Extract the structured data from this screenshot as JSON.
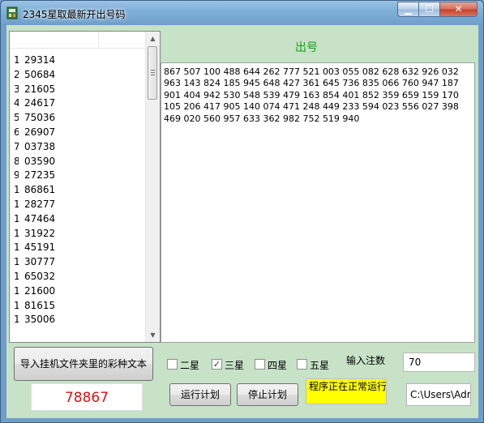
{
  "window": {
    "title": "2345星取最新开出号码"
  },
  "titlebar": {
    "minimize_glyph": "▁",
    "maximize_glyph": "☐",
    "close_glyph": "✕",
    "icon": "app-icon"
  },
  "list": {
    "rows": [
      {
        "idx": "1",
        "value": "29314"
      },
      {
        "idx": "2",
        "value": "50684"
      },
      {
        "idx": "3",
        "value": "21605"
      },
      {
        "idx": "4",
        "value": "24617"
      },
      {
        "idx": "5",
        "value": "75036"
      },
      {
        "idx": "6",
        "value": "26907"
      },
      {
        "idx": "7",
        "value": "03738"
      },
      {
        "idx": "8",
        "value": "03590"
      },
      {
        "idx": "9",
        "value": "27235"
      },
      {
        "idx": "1",
        "value": "86861"
      },
      {
        "idx": "1",
        "value": "28277"
      },
      {
        "idx": "1",
        "value": "47464"
      },
      {
        "idx": "1",
        "value": "31922"
      },
      {
        "idx": "1",
        "value": "45191"
      },
      {
        "idx": "1",
        "value": "30777"
      },
      {
        "idx": "1",
        "value": "65032"
      },
      {
        "idx": "1",
        "value": "21600"
      },
      {
        "idx": "1",
        "value": "81615"
      },
      {
        "idx": "1",
        "value": "35006"
      }
    ],
    "scroll_up_glyph": "▲",
    "scroll_down_glyph": "▼"
  },
  "result": {
    "title": "出号",
    "numbers": "867 507 100 488 644 262 777 521 003 055 082 628 632 926 032 963 143 824 185 945 648 427 361 645 736 835 066 760 947 187 901 404 942 530 548 539 479 163 854 401 852 359 659 159 170 105 206 417 905 140 074 471 248 449 233 594 023 556 027 398 469 020 560 957 633 362 982 752 519 940"
  },
  "buttons": {
    "import_label": "导入挂机文件夹里的彩种文本",
    "run_label": "运行计划",
    "stop_label": "停止计划"
  },
  "display": {
    "current_number": "78867"
  },
  "checkboxes": {
    "two_star": {
      "label": "二星",
      "checked": false,
      "mark": ""
    },
    "three_star": {
      "label": "三星",
      "checked": true,
      "mark": "✓"
    },
    "four_star": {
      "label": "四星",
      "checked": false,
      "mark": ""
    },
    "five_star": {
      "label": "五星",
      "checked": false,
      "mark": ""
    }
  },
  "bet": {
    "label": "输入注数",
    "value": "70"
  },
  "status": {
    "text": "程序正在正常运行"
  },
  "path": {
    "value": "C:\\Users\\Adm"
  }
}
